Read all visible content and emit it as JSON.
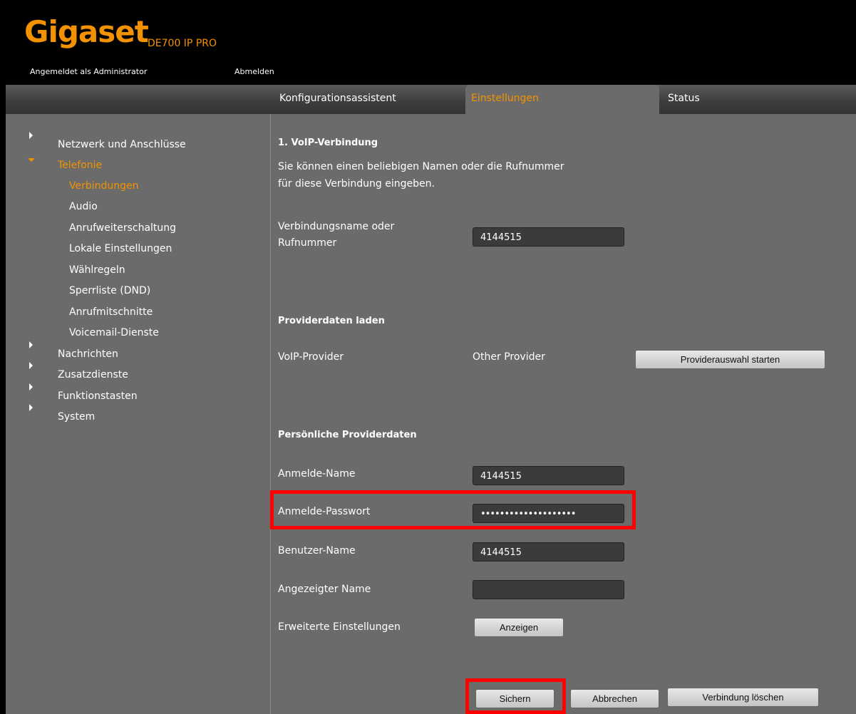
{
  "header": {
    "brand": "Gigaset",
    "model": "DE700 IP PRO",
    "login_info": "Angemeldet als Administrator",
    "logout": "Abmelden"
  },
  "tabs": [
    {
      "label": "Konfigurationsassistent",
      "active": false
    },
    {
      "label": "Einstellungen",
      "active": true
    },
    {
      "label": "Status",
      "active": false
    }
  ],
  "sidebar": {
    "items": [
      {
        "label": "Netzwerk und Anschlüsse",
        "icon": "triangle-right-icon"
      },
      {
        "label": "Telefonie",
        "icon": "triangle-down-icon",
        "active": true
      },
      {
        "label": "Verbindungen",
        "active": true
      },
      {
        "label": "Audio"
      },
      {
        "label": "Anrufweiterschaltung"
      },
      {
        "label": "Lokale Einstellungen"
      },
      {
        "label": "Wählregeln"
      },
      {
        "label": "Sperrliste (DND)"
      },
      {
        "label": "Anrufmitschnitte"
      },
      {
        "label": "Voicemail-Dienste"
      },
      {
        "label": "Nachrichten",
        "icon": "triangle-right-icon"
      },
      {
        "label": "Zusatzdienste",
        "icon": "triangle-right-icon"
      },
      {
        "label": "Funktionstasten",
        "icon": "triangle-right-icon"
      },
      {
        "label": "System",
        "icon": "triangle-right-icon"
      }
    ]
  },
  "main": {
    "voip_section": {
      "heading": "1. VoIP-Verbindung",
      "description_line1": "Sie können einen beliebigen Namen oder die Rufnummer",
      "description_line2": "für diese Verbindung eingeben.",
      "conn_name_label_line1": "Verbindungsname oder",
      "conn_name_label_line2": "Rufnummer",
      "conn_name_value": "4144515"
    },
    "provider_section": {
      "heading": "Providerdaten laden",
      "provider_label": "VoIP-Provider",
      "provider_value": "Other Provider",
      "provider_button": "Providerauswahl starten"
    },
    "personal_section": {
      "heading": "Persönliche Providerdaten",
      "login_name_label": "Anmelde-Name",
      "login_name_value": "4144515",
      "password_label": "Anmelde-Passwort",
      "password_value": "••••••••••••••••••••",
      "user_name_label": "Benutzer-Name",
      "user_name_value": "4144515",
      "display_name_label": "Angezeigter Name",
      "display_name_value": "",
      "advanced_label": "Erweiterte Einstellungen",
      "advanced_button": "Anzeigen"
    },
    "footer_buttons": {
      "save": "Sichern",
      "cancel": "Abbrechen",
      "delete": "Verbindung löschen"
    }
  },
  "colors": {
    "accent": "#f39200",
    "highlight": "#ff0000",
    "background": "#6b6b6b"
  }
}
